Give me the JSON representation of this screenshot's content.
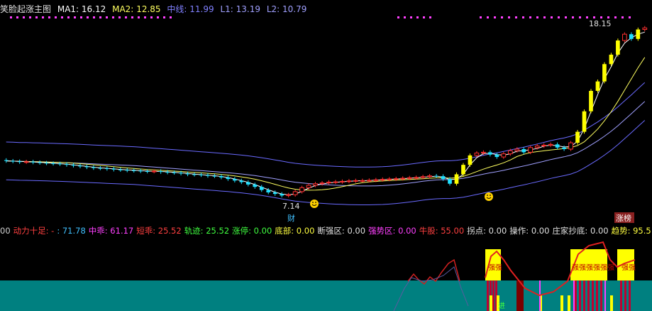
{
  "legend": {
    "title": "笑脸起涨主图",
    "ma1_label": "MA1:",
    "ma1_value": "16.12",
    "ma2_label": "MA2:",
    "ma2_value": "12.85",
    "mid_label": "中线:",
    "mid_value": "11.99",
    "l1_label": "L1:",
    "l1_value": "13.19",
    "l2_label": "L2:",
    "l2_value": "10.79"
  },
  "annotations": {
    "high_price": "18.15",
    "low_price": "7.14",
    "cai_tag": "财",
    "zhangting_tag": "涨榜"
  },
  "indicators": [
    {
      "label": "00",
      "color": "#d0d0d0"
    },
    {
      "label": "动力十足: -",
      "color": "#ff4040"
    },
    {
      "label": ": 71.78",
      "color": "#40c0ff"
    },
    {
      "label": "中乖: 61.17",
      "color": "#ff40ff"
    },
    {
      "label": "短乖: 25.52",
      "color": "#ff4040"
    },
    {
      "label": "轨迹: 25.52",
      "color": "#40ff40"
    },
    {
      "label": "涨停: 0.00",
      "color": "#40ff40"
    },
    {
      "label": "底部: 0.00",
      "color": "#ffff40"
    },
    {
      "label": "断强区: 0.00",
      "color": "#e0e0e0"
    },
    {
      "label": "强势区: 0.00",
      "color": "#ff40ff"
    },
    {
      "label": "牛股: 55.00",
      "color": "#ff4040"
    },
    {
      "label": "拐点: 0.00",
      "color": "#e0e0e0"
    },
    {
      "label": "操作: 0.00",
      "color": "#e0e0e0"
    },
    {
      "label": "庄家抄底: 0.00",
      "color": "#e0e0e0"
    },
    {
      "label": "趋势: 95.5",
      "color": "#ffff40"
    }
  ],
  "sub_tags": {
    "strong": "强强",
    "jin": "进"
  },
  "colors": {
    "up": "#ff3030",
    "down": "#20e0ff",
    "band": "#6a6aff",
    "ma1": "#ffffff",
    "ma2": "#ffff60",
    "mid": "#a0a0ff",
    "teal": "#008080",
    "yellow": "#ffff00",
    "magenta": "#ff40ff"
  },
  "chart_data": {
    "type": "candlestick",
    "price_range": [
      6.5,
      18.5
    ],
    "high": 18.15,
    "low": 7.14,
    "closes": [
      9.45,
      9.42,
      9.38,
      9.4,
      9.36,
      9.33,
      9.3,
      9.28,
      9.25,
      9.2,
      9.15,
      9.1,
      9.05,
      9.0,
      8.98,
      8.95,
      8.9,
      8.88,
      8.85,
      8.83,
      8.8,
      8.78,
      8.8,
      8.75,
      8.72,
      8.7,
      8.65,
      8.6,
      8.58,
      8.55,
      8.5,
      8.48,
      8.4,
      8.3,
      8.2,
      8.1,
      7.95,
      7.8,
      7.6,
      7.45,
      7.35,
      7.25,
      7.3,
      7.5,
      7.75,
      7.9,
      8.0,
      8.05,
      8.1,
      8.12,
      8.15,
      8.18,
      8.2,
      8.2,
      8.22,
      8.25,
      8.28,
      8.3,
      8.32,
      8.35,
      8.38,
      8.4,
      8.45,
      8.5,
      8.48,
      8.3,
      8.0,
      8.6,
      9.2,
      9.8,
      9.95,
      10.0,
      9.85,
      9.7,
      9.9,
      10.1,
      10.2,
      10.0,
      10.3,
      10.4,
      10.45,
      10.5,
      10.3,
      10.2,
      10.6,
      11.3,
      12.6,
      13.9,
      14.5,
      15.6,
      16.2,
      17.1,
      17.5,
      17.2,
      17.8,
      17.9
    ]
  }
}
